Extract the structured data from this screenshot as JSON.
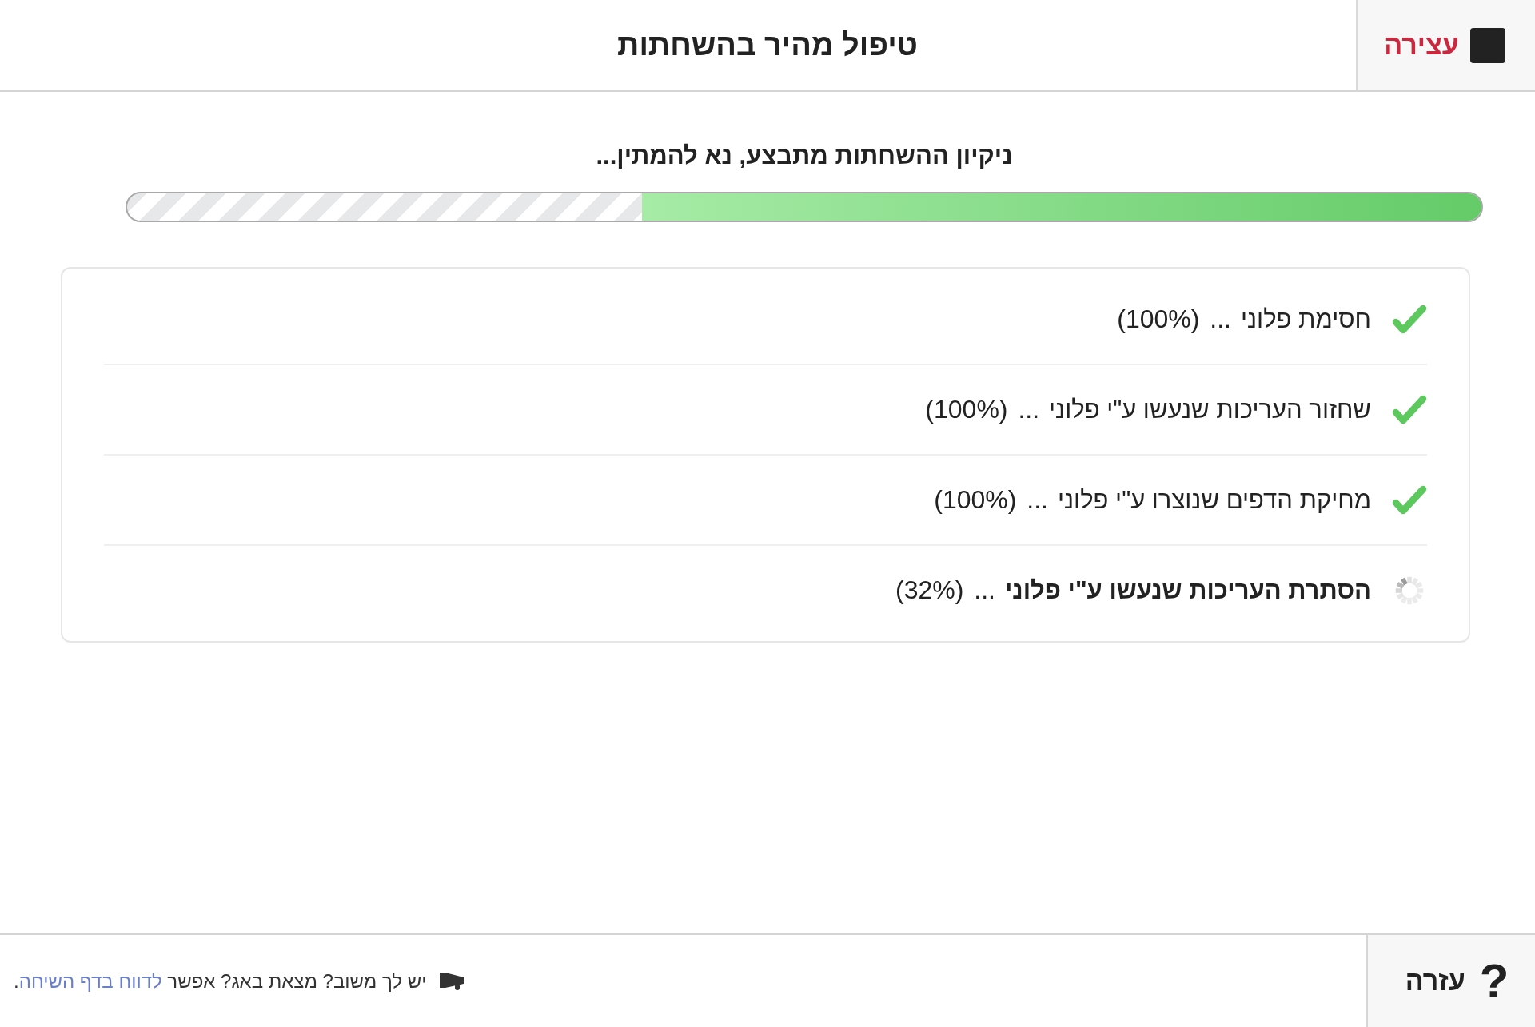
{
  "header": {
    "title": "טיפול מהיר בהשחתות",
    "stop_button": {
      "label": "עצירה"
    }
  },
  "status_text": "ניקיון ההשחתות מתבצע, נא להמתין...",
  "progress": {
    "level": 0.62
  },
  "steps": [
    {
      "kind": "done",
      "label": "חסימת פלוני",
      "reading": "... (100%)"
    },
    {
      "kind": "done",
      "label": "שחזור העריכות שנעשו ע\"י פלוני",
      "reading": "... (100%)"
    },
    {
      "kind": "done",
      "label": "מחיקת הדפים שנוצרו ע\"י פלוני",
      "reading": "... (100%)"
    },
    {
      "kind": "running",
      "label": "הסתרת העריכות שנעשו ע\"י פלוני",
      "reading": "... (32%)"
    }
  ],
  "footer": {
    "feedback": {
      "text": "יש לך משוב? מצאת באג? אפשר",
      "link": "לדווח בדף השיחה",
      "end": "."
    },
    "help_button": {
      "icon_text": "?",
      "label": "עזרה"
    }
  }
}
